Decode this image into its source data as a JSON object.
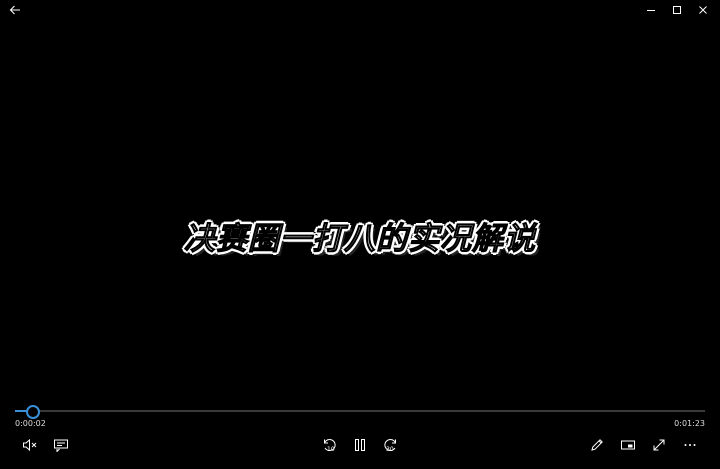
{
  "player": {
    "caption": "决赛圈一打八的实况解说",
    "current_time": "0:00:02",
    "total_time": "0:01:23",
    "progress": 0.024,
    "skip_back_seconds": "10",
    "skip_forward_seconds": "30",
    "accent_color": "#3a8fd8"
  },
  "icons": {
    "back": "back-arrow-icon",
    "minimize": "minimize-icon",
    "maximize": "maximize-icon",
    "close": "close-icon",
    "volume": "volume-muted-icon",
    "subtitles": "subtitles-icon",
    "skip_back": "skip-back-icon",
    "pause": "pause-icon",
    "skip_forward": "skip-forward-icon",
    "edit": "pencil-icon",
    "mini_view": "mini-view-icon",
    "fullscreen": "fullscreen-icon",
    "more": "more-options-icon"
  }
}
